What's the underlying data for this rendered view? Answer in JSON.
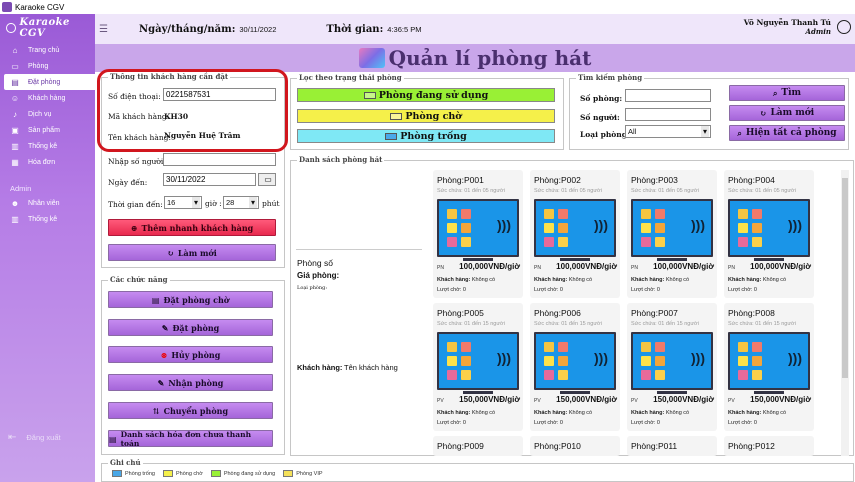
{
  "window": {
    "title": "Karaoke CGV"
  },
  "sidebar": {
    "brand": "Karaoke CGV",
    "items": [
      {
        "label": "Trang chủ",
        "icon": "home-icon"
      },
      {
        "label": "Phòng",
        "icon": "room-icon"
      },
      {
        "label": "Đặt phòng",
        "icon": "booking-icon",
        "active": true
      },
      {
        "label": "Khách hàng",
        "icon": "customer-icon"
      },
      {
        "label": "Dịch vụ",
        "icon": "service-icon"
      },
      {
        "label": "Sản phẩm",
        "icon": "product-icon"
      },
      {
        "label": "Thống kê",
        "icon": "stats-icon"
      },
      {
        "label": "Hóa đơn",
        "icon": "invoice-icon"
      }
    ],
    "admin_label": "Admin",
    "admin_items": [
      {
        "label": "Nhân viên",
        "icon": "staff-icon"
      },
      {
        "label": "Thống kê",
        "icon": "stats-icon"
      }
    ],
    "logout": "Đăng xuất"
  },
  "topbar": {
    "date_label": "Ngày/tháng/năm:",
    "date_value": "30/11/2022",
    "time_label": "Thời gian:",
    "time_value": "4:36:5 PM",
    "user_name": "Võ Nguyễn Thanh Tú",
    "user_role": "Admin"
  },
  "page_title": "Quản lí phòng hát",
  "customer_info": {
    "legend": "Thông tin khách hàng cần đặt",
    "phone_label": "Số điện thoại:",
    "phone_value": "0221587531",
    "id_label": "Mã khách hàng:",
    "id_value": "KH30",
    "name_label": "Tên khách hàng:",
    "name_value": "Nguyễn Huệ Trâm",
    "people_label": "Nhập số người:",
    "people_value": "",
    "date_label": "Ngày đến:",
    "date_value": "30/11/2022",
    "time_label": "Thời gian đến:",
    "hour_value": "16",
    "hour_unit": "giờ :",
    "minute_value": "28",
    "minute_unit": "phút",
    "quick_add_label": "Thêm nhanh khách hàng",
    "refresh_label": "Làm mới"
  },
  "functions": {
    "legend": "Các chức năng",
    "buttons": [
      "Đặt phòng chờ",
      "Đặt phòng",
      "Hủy phòng",
      "Nhận phòng",
      "Chuyển phòng",
      "Danh sách hóa đơn chưa thanh toán"
    ]
  },
  "filter": {
    "legend": "Lọc theo trạng thái phòng",
    "in_use": "Phòng đang sử dụng",
    "waiting": "Phòng chờ",
    "empty": "Phòng trống",
    "colors": {
      "in_use": "#99f035",
      "waiting": "#f5f04a",
      "empty": "#7fe8f5"
    }
  },
  "search": {
    "legend": "Tìm kiếm phòng",
    "room_no_label": "Số phòng:",
    "people_label": "Số người:",
    "type_label": "Loại phòng:",
    "type_value": "All",
    "find_label": "Tìm",
    "refresh_label": "Làm mới",
    "show_all_label": "Hiện tất cả phòng"
  },
  "room_list": {
    "legend": "Danh sách phòng hát",
    "detail_room_label": "Phòng số",
    "detail_price_label": "Giá phòng:",
    "detail_type_label": "Loại phòng:",
    "detail_customer_label": "Khách hàng:",
    "detail_customer_value": "Tên khách hàng",
    "rooms": [
      {
        "name": "Phòng:P001",
        "cap": "Sức chứa: 01 đến 05 người",
        "code": "PN",
        "price": "100,000VNĐ/giờ",
        "kh_label": "Khách hàng:",
        "kh": "Không có",
        "lc_label": "Lượt chờ:",
        "lc": "0"
      },
      {
        "name": "Phòng:P002",
        "cap": "Sức chứa: 01 đến 05 người",
        "code": "PN",
        "price": "100,000VNĐ/giờ",
        "kh_label": "Khách hàng:",
        "kh": "Không có",
        "lc_label": "Lượt chờ:",
        "lc": "0"
      },
      {
        "name": "Phòng:P003",
        "cap": "Sức chứa: 01 đến 05 người",
        "code": "PN",
        "price": "100,000VNĐ/giờ",
        "kh_label": "Khách hàng:",
        "kh": "Không có",
        "lc_label": "Lượt chờ:",
        "lc": "0"
      },
      {
        "name": "Phòng:P004",
        "cap": "Sức chứa: 01 đến 05 người",
        "code": "PN",
        "price": "100,000VNĐ/giờ",
        "kh_label": "Khách hàng:",
        "kh": "Không có",
        "lc_label": "Lượt chờ:",
        "lc": "0"
      },
      {
        "name": "Phòng:P005",
        "cap": "Sức chứa: 01 đến 15 người",
        "code": "PV",
        "price": "150,000VNĐ/giờ",
        "kh_label": "Khách hàng:",
        "kh": "Không có",
        "lc_label": "Lượt chờ:",
        "lc": "0"
      },
      {
        "name": "Phòng:P006",
        "cap": "Sức chứa: 01 đến 15 người",
        "code": "PV",
        "price": "150,000VNĐ/giờ",
        "kh_label": "Khách hàng:",
        "kh": "Không có",
        "lc_label": "Lượt chờ:",
        "lc": "0"
      },
      {
        "name": "Phòng:P007",
        "cap": "Sức chứa: 01 đến 15 người",
        "code": "PV",
        "price": "150,000VNĐ/giờ",
        "kh_label": "Khách hàng:",
        "kh": "Không có",
        "lc_label": "Lượt chờ:",
        "lc": "0"
      },
      {
        "name": "Phòng:P008",
        "cap": "Sức chứa: 01 đến 15 người",
        "code": "PV",
        "price": "150,000VNĐ/giờ",
        "kh_label": "Khách hàng:",
        "kh": "Không có",
        "lc_label": "Lượt chờ:",
        "lc": "0"
      },
      {
        "name": "Phòng:P009"
      },
      {
        "name": "Phòng:P010"
      },
      {
        "name": "Phòng:P011"
      },
      {
        "name": "Phòng:P012"
      }
    ]
  },
  "notes": {
    "legend": "Ghi chú",
    "items": [
      {
        "label": "Phòng trống",
        "color": "#7fe8f5"
      },
      {
        "label": "Phòng chờ",
        "color": "#f5f04a"
      },
      {
        "label": "Phòng đang sử dụng",
        "color": "#99f035"
      },
      {
        "label": "Phòng VIP",
        "color": "#f5e15a"
      }
    ]
  }
}
